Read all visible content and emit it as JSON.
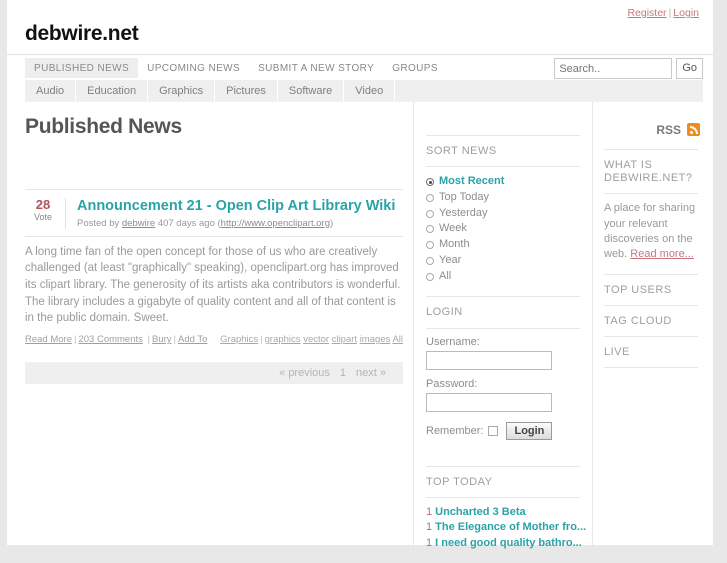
{
  "account": {
    "register": "Register",
    "separator": "|",
    "login": "Login"
  },
  "site": {
    "logo": "debwire.net"
  },
  "nav": {
    "items": [
      {
        "label": "PUBLISHED NEWS",
        "active": true
      },
      {
        "label": "UPCOMING NEWS",
        "active": false
      },
      {
        "label": "SUBMIT A NEW STORY",
        "active": false
      },
      {
        "label": "GROUPS",
        "active": false
      }
    ]
  },
  "search": {
    "placeholder": "Search..",
    "value": "",
    "go_label": "Go"
  },
  "categories": [
    "Audio",
    "Education",
    "Graphics",
    "Pictures",
    "Software",
    "Video"
  ],
  "main": {
    "page_title": "Published News",
    "rss_label": "RSS",
    "story": {
      "vote_count": "28",
      "vote_label": "Vote",
      "title": "Announcement 21 - Open Clip Art Library Wiki",
      "meta_posted_by": "Posted by",
      "meta_author": "debwire",
      "meta_age": "407 days ago (",
      "meta_url": "http://www.openclipart.org",
      "meta_url_close": ")",
      "description": "A long time fan of the open concept for those of us who are creatively challenged (at least \"graphically\" speaking), openclipart.org has improved its clipart library. The generosity of its artists aka contributors is wonderful. The library includes a gigabyte of quality content and all of that content is in the public domain. Sweet.",
      "actions": {
        "read_more": "Read More",
        "comments": "203 Comments",
        "bury": "Bury",
        "add_to": "Add To"
      },
      "tags": {
        "category": "Graphics",
        "list": [
          "graphics",
          "vector",
          "clipart",
          "images",
          "All"
        ]
      }
    },
    "pagination": {
      "previous": "« previous",
      "current": "1",
      "next": "next »"
    }
  },
  "sidebar_mid": {
    "sort_news": {
      "heading": "SORT NEWS",
      "options": [
        {
          "label": "Most Recent",
          "selected": true
        },
        {
          "label": "Top Today",
          "selected": false
        },
        {
          "label": "Yesterday",
          "selected": false
        },
        {
          "label": "Week",
          "selected": false
        },
        {
          "label": "Month",
          "selected": false
        },
        {
          "label": "Year",
          "selected": false
        },
        {
          "label": "All",
          "selected": false
        }
      ]
    },
    "login": {
      "heading": "LOGIN",
      "username_label": "Username:",
      "username_value": "",
      "password_label": "Password:",
      "password_value": "",
      "remember_label": "Remember:",
      "submit_label": "Login"
    },
    "top_today": {
      "heading": "TOP TODAY",
      "items": [
        {
          "num": "1",
          "title": "Uncharted 3 Beta"
        },
        {
          "num": "1",
          "title": "The Elegance of Mother fro..."
        },
        {
          "num": "1",
          "title": "I need good quality bathro..."
        }
      ]
    }
  },
  "sidebar_right": {
    "about": {
      "heading": "WHAT IS DEBWIRE.NET?",
      "text": "A place for sharing your relevant discoveries on the web. ",
      "read_more": "Read more..."
    },
    "top_users_heading": "TOP USERS",
    "tag_cloud_heading": "TAG CLOUD",
    "live_heading": "LIVE"
  },
  "colors": {
    "accent_teal": "#2aa3a8",
    "link_red": "#c6787e",
    "vote_red": "#b0545c",
    "rss_orange": "#f08b1d",
    "page_bg": "#e8e8e8"
  }
}
